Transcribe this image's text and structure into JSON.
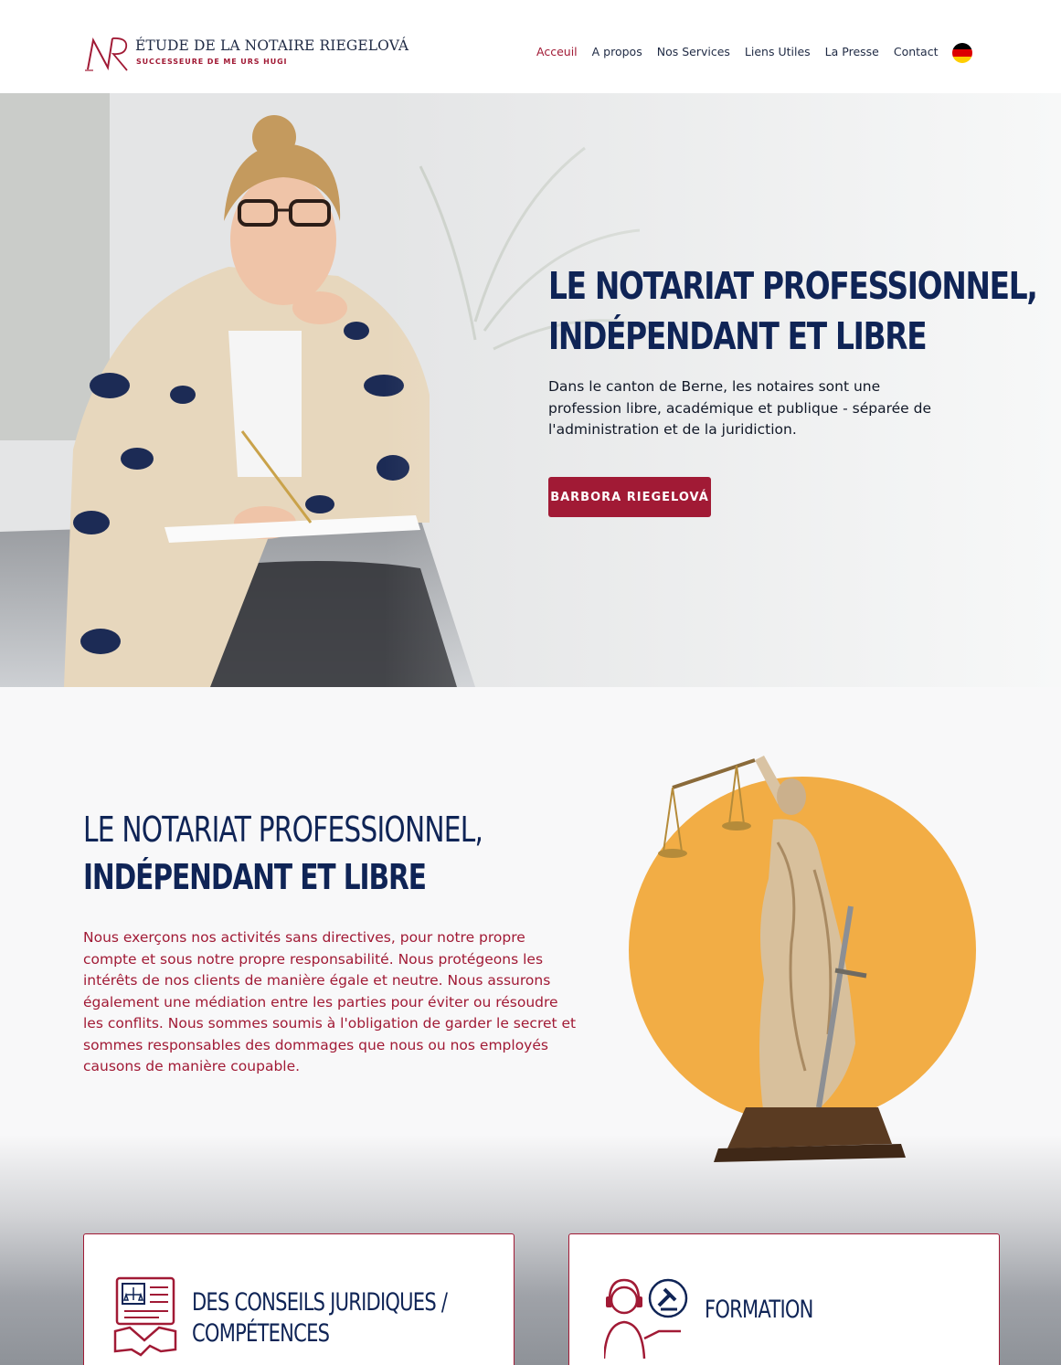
{
  "header": {
    "logo_title": "ÉTUDE DE LA NOTAIRE RIEGELOVÁ",
    "logo_subtitle": "SUCCESSEURE DE ME URS HUGI",
    "logo_monogram": "NR",
    "nav": [
      {
        "label": "Acceuil",
        "active": true
      },
      {
        "label": "A propos",
        "active": false
      },
      {
        "label": "Nos Services",
        "active": false
      },
      {
        "label": "Liens Utiles",
        "active": false
      },
      {
        "label": "La Presse",
        "active": false
      },
      {
        "label": "Contact",
        "active": false
      }
    ],
    "language_flag": "german-flag-icon"
  },
  "hero": {
    "title_line1": "LE NOTARIAT PROFESSIONNEL,",
    "title_line2": "INDÉPENDANT ET LIBRE",
    "text": "Dans le canton de Berne, les notaires sont une profession libre, académique et publique - séparée de l'administration et de la juridiction.",
    "button_label": "BARBORA RIEGELOVÁ"
  },
  "about": {
    "title_line1": "LE NOTARIAT PROFESSIONNEL,",
    "title_line2": "INDÉPENDANT ET LIBRE",
    "text": "Nous exerçons nos activités sans directives, pour notre propre compte et sous notre propre responsabilité. Nous protégeons les intérêts de nos clients de manière égale et neutre. Nous assurons également une médiation entre les parties pour éviter ou résoudre les conflits. Nous sommes soumis à l'obligation de garder le secret et sommes responsables des dommages que nous ou nos employés causons de manière coupable."
  },
  "cards": [
    {
      "title_line1": "DES CONSEILS JURIDIQUES /",
      "title_line2": "COMPÉTENCES",
      "icon": "legal-contract-handshake-icon"
    },
    {
      "title_line1": "FORMATION",
      "title_line2": "",
      "icon": "support-agent-gavel-icon"
    }
  ],
  "colors": {
    "brand_red": "#a11a35",
    "navy": "#0f2456",
    "accent_orange": "#f2ad45"
  }
}
